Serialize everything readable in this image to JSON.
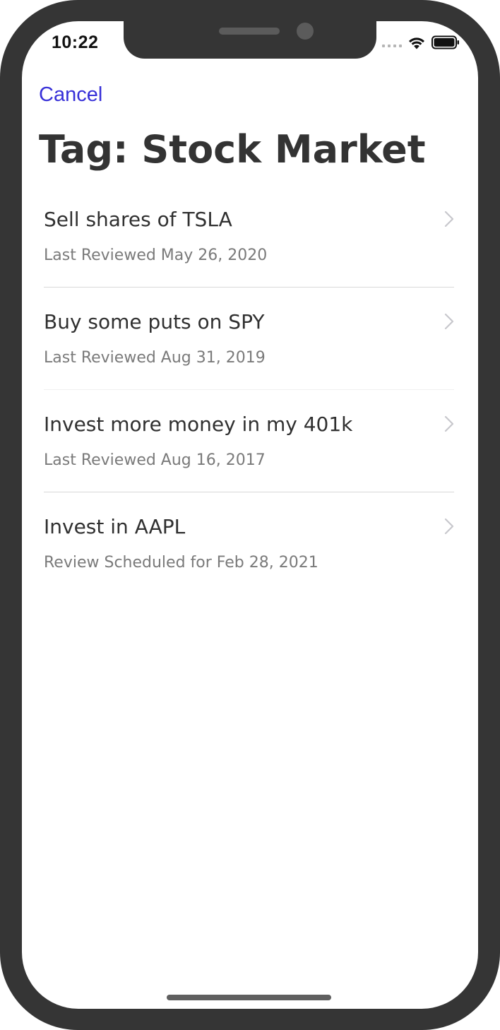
{
  "status_bar": {
    "time": "10:22",
    "icons": [
      "cellular-signal-icon",
      "wifi-icon",
      "battery-icon"
    ]
  },
  "nav": {
    "cancel_label": "Cancel"
  },
  "page": {
    "title": "Tag: Stock Market"
  },
  "list": {
    "items": [
      {
        "title": "Sell shares of TSLA",
        "subtitle": "Last Reviewed May 26, 2020"
      },
      {
        "title": "Buy some puts on SPY",
        "subtitle": "Last Reviewed Aug 31, 2019"
      },
      {
        "title": "Invest more money in my 401k",
        "subtitle": "Last Reviewed Aug 16, 2017"
      },
      {
        "title": "Invest in AAPL",
        "subtitle": "Review Scheduled for Feb 28, 2021"
      }
    ]
  },
  "colors": {
    "accent": "#3730d8",
    "title_text": "#333333",
    "subtitle_text": "#7a7a7a",
    "device_frame": "#353535"
  }
}
